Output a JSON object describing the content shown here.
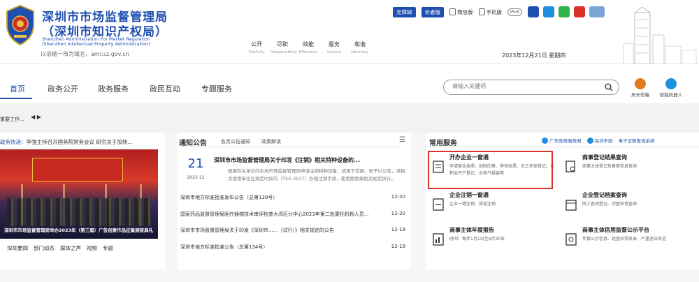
{
  "header": {
    "title_line1": "深圳市市场监督管理局",
    "title_line2": "（深圳市知识产权局）",
    "en_line1": "Shenzhen Administration For Market Regulation",
    "en_line2": "(Shenzhen Intellectual Property Administration)",
    "domain_text": "以浓缩一市为域名，amr.sz.gov.cn",
    "categories": [
      {
        "cn": "公开",
        "en": "Publicity"
      },
      {
        "cn": "尽职",
        "en": "Responsibility"
      },
      {
        "cn": "效能",
        "en": "Efficiency"
      },
      {
        "cn": "服务",
        "en": "Service"
      },
      {
        "cn": "和谐",
        "en": "Harmony"
      }
    ],
    "top_buttons": {
      "accessible": "无障碍",
      "elder": "长者版",
      "weibo": "微信版",
      "mobile": "手机版",
      "ipv6": "IPv6"
    },
    "date": "2023年12月21日  星期四"
  },
  "nav": {
    "items": [
      "首页",
      "政务公开",
      "政务服务",
      "政民互动",
      "专题服务"
    ],
    "active_index": 0,
    "search_placeholder": "请输入关键词",
    "quick": [
      {
        "label": "局长信箱",
        "color": "#e07a1f"
      },
      {
        "label": "智能机器人",
        "color": "#1f8fe0"
      }
    ]
  },
  "band": {
    "ticker": "重要工作...",
    "arrows": "◀ ▶"
  },
  "left": {
    "news_label": "政务快递：",
    "news_text": "李强主持召开国务院常务会议 研究关于加快...",
    "photo_caption": "深圳市市场监督管理局举办2023年（第三届）广告创意作品征集颁奖典礼",
    "tabs": [
      "深圳要闻",
      "部门动态",
      "媒体之声",
      "视频",
      "专题"
    ]
  },
  "middle": {
    "title": "通知公告",
    "tabs": [
      "各类公告通知",
      "政策解读"
    ],
    "menu": "☰",
    "featured": {
      "day": "21",
      "ym": "2023-12",
      "title": "深圳市市场监督管理局关于印发《注销》相关特种设备的...",
      "desc": "根据有关单位向本局市场监督管理局申请注销特种设备，适用于范围，现予以公告，请相关使用单位在规定时间内（TSG 2017）办理注销手续，使用期限按相关规定执行。"
    },
    "notices": [
      {
        "title": "深圳市地方标准批准发布公告（总第139号）",
        "date": "12-20"
      },
      {
        "title": "国家药品监督管理局医疗器械技术审评检查大湾区分中心2023年第二批委托机构人员...",
        "date": "12-20"
      },
      {
        "title": "深圳市市场监督管理局关于印发《深圳市......（试行）》相关规定的公告",
        "date": "12-19"
      },
      {
        "title": "深圳市地方标准批准公告（总第134号）",
        "date": "12-19"
      }
    ]
  },
  "right": {
    "title": "常用服务",
    "links": [
      "广东政务服务网",
      "深圳市政",
      "电子证照查询系统"
    ],
    "services": [
      {
        "title": "开办企业一窗通",
        "desc": "申请营业执照、刻制印章、申领发票、员工参保登记、公积金开户登记、水电气报装等"
      },
      {
        "title": "商事登记结果查询",
        "desc": "商事主体登记及备案信息查询"
      },
      {
        "title": "企业注销一窗通",
        "desc": "企业一键注销、简易注销"
      },
      {
        "title": "企业登记档案查询",
        "desc": "网上查询登记、完整申请查询"
      },
      {
        "title": "商事主体年度报告",
        "desc": "时间：每年1月1日至6月30日"
      },
      {
        "title": "商事主体信用监督公示平台",
        "desc": "年报公示信息、经营异常名录、严重违法失信"
      }
    ]
  }
}
